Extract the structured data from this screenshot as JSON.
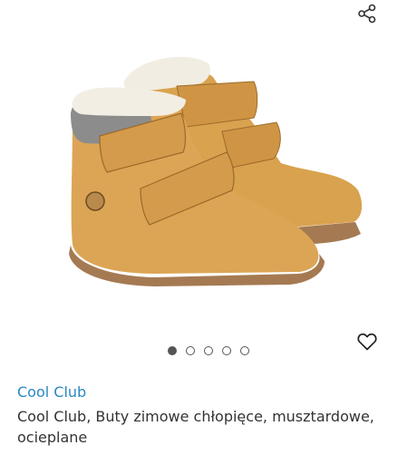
{
  "header": {
    "share_icon": "share-icon"
  },
  "product": {
    "image": "winter-boots-photo",
    "carousel": {
      "total": 5,
      "active_index": 0
    },
    "favorite_icon": "heart-outline-icon",
    "brand": "Cool Club",
    "name": "Cool Club, Buty zimowe chłopięce, musztardowe, ocieplane"
  },
  "colors": {
    "brand_link": "#2a88c2",
    "text": "#333333",
    "dots": "#555555"
  }
}
